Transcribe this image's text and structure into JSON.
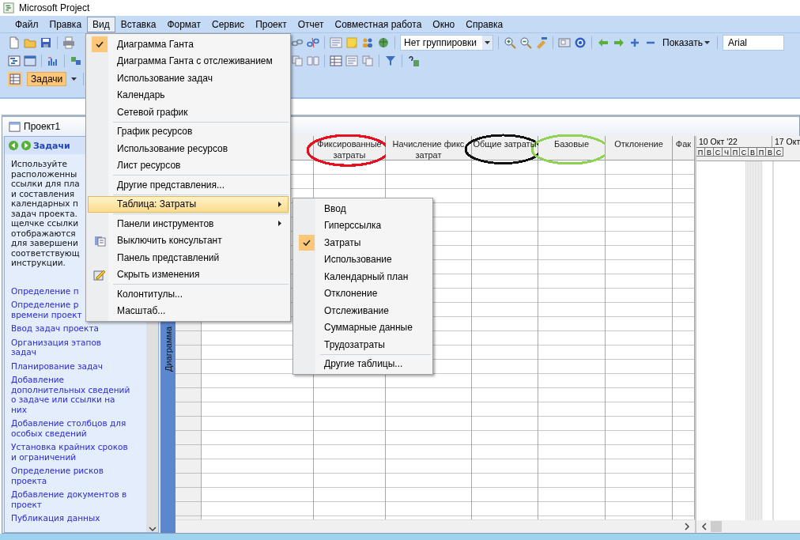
{
  "window": {
    "title": "Microsoft Project"
  },
  "menu_bar": [
    {
      "label": "Файл",
      "selected": false
    },
    {
      "label": "Правка",
      "selected": false
    },
    {
      "label": "Вид",
      "selected": true
    },
    {
      "label": "Вставка",
      "selected": false
    },
    {
      "label": "Формат",
      "selected": false
    },
    {
      "label": "Сервис",
      "selected": false
    },
    {
      "label": "Проект",
      "selected": false
    },
    {
      "label": "Отчет",
      "selected": false
    },
    {
      "label": "Совместная работа",
      "selected": false
    },
    {
      "label": "Окно",
      "selected": false
    },
    {
      "label": "Справка",
      "selected": false
    }
  ],
  "toolbar": {
    "grouping_combo": "Нет группировки",
    "show_button": "Показать",
    "font_field": "Arial",
    "view_button": "Задачи"
  },
  "project_window": {
    "title": "Проект1"
  },
  "task_pane": {
    "title": "Задачи",
    "description": "Используйте\nрасположенны\nссылки для пла\nи составления\nкалендарных п\nзадач проекта.\nщелчке ссылки\nотображаются\nдля завершени\nсоответствующ\nинструкции.",
    "links": [
      "Определение п",
      "Определение р\nвремени проект",
      "Ввод задач проекта",
      "Организация этапов\nзадач",
      "Планирование задач",
      "Добавление\nдополнительных сведений\nо задаче или ссылки на\nних",
      "Добавление столбцов для\nособых сведений",
      "Установка крайних сроков\nи ограничений",
      "Определение рисков\nпроекта",
      "Добавление документов в\nпроект",
      "Публикация данных"
    ]
  },
  "view_bar": {
    "label": "Диаграмма"
  },
  "table": {
    "columns": [
      {
        "label": "Фиксированные\nзатраты",
        "color": "#e8101e"
      },
      {
        "label": "Начисление фикс\nзатрат"
      },
      {
        "label": "Общие затраты",
        "color": "#111111"
      },
      {
        "label": "Базовые",
        "color": "#8fd150"
      },
      {
        "label": "Отклонение"
      },
      {
        "label": "Фак"
      }
    ]
  },
  "gantt": {
    "weeks": [
      "10 Окт '22",
      "17 Окт"
    ],
    "days": [
      "П",
      "В",
      "С",
      "Ч",
      "П",
      "С",
      "В",
      "П",
      "В",
      "С"
    ]
  },
  "view_menu": {
    "items": [
      {
        "label": "Диаграмма Ганта",
        "kind": "plain",
        "checked": true,
        "selected": false,
        "separator_after": false
      },
      {
        "label": "Диаграмма Ганта с отслеживанием",
        "kind": "plain",
        "checked": false,
        "selected": false,
        "separator_after": false
      },
      {
        "label": "Использование задач",
        "kind": "plain",
        "checked": false,
        "selected": false,
        "separator_after": false
      },
      {
        "label": "Календарь",
        "kind": "plain",
        "checked": false,
        "selected": false,
        "separator_after": false
      },
      {
        "label": "Сетевой график",
        "kind": "plain",
        "checked": false,
        "selected": false,
        "separator_after": true
      },
      {
        "label": "График ресурсов",
        "kind": "plain",
        "checked": false,
        "selected": false,
        "separator_after": false
      },
      {
        "label": "Использование ресурсов",
        "kind": "plain",
        "checked": false,
        "selected": false,
        "separator_after": false
      },
      {
        "label": "Лист ресурсов",
        "kind": "plain",
        "checked": false,
        "selected": false,
        "separator_after": true
      },
      {
        "label": "Другие представления...",
        "kind": "plain",
        "checked": false,
        "selected": false,
        "separator_after": true
      },
      {
        "label": "Таблица: Затраты",
        "kind": "submenu",
        "checked": false,
        "selected": true,
        "separator_after": true
      },
      {
        "label": "Панели инструментов",
        "kind": "submenu",
        "checked": false,
        "selected": false,
        "separator_after": false
      },
      {
        "label": "Выключить консультант",
        "kind": "icon",
        "checked": false,
        "selected": false,
        "separator_after": false
      },
      {
        "label": "Панель представлений",
        "kind": "plain",
        "checked": false,
        "selected": false,
        "separator_after": false
      },
      {
        "label": "Скрыть изменения",
        "kind": "icon",
        "checked": false,
        "selected": false,
        "separator_after": true
      },
      {
        "label": "Колонтитулы...",
        "kind": "plain",
        "checked": false,
        "selected": false,
        "separator_after": false
      },
      {
        "label": "Масштаб...",
        "kind": "plain",
        "checked": false,
        "selected": false,
        "separator_after": false
      }
    ]
  },
  "table_submenu": {
    "items": [
      {
        "label": "Ввод",
        "kind": "plain",
        "checked": false,
        "selected": false,
        "separator_after": false
      },
      {
        "label": "Гиперссылка",
        "kind": "plain",
        "checked": false,
        "selected": false,
        "separator_after": false
      },
      {
        "label": "Затраты",
        "kind": "plain",
        "checked": true,
        "selected": false,
        "separator_after": false
      },
      {
        "label": "Использование",
        "kind": "plain",
        "checked": false,
        "selected": false,
        "separator_after": false
      },
      {
        "label": "Календарный план",
        "kind": "plain",
        "checked": false,
        "selected": false,
        "separator_after": false
      },
      {
        "label": "Отклонение",
        "kind": "plain",
        "checked": false,
        "selected": false,
        "separator_after": false
      },
      {
        "label": "Отслеживание",
        "kind": "plain",
        "checked": false,
        "selected": false,
        "separator_after": false
      },
      {
        "label": "Суммарные данные",
        "kind": "plain",
        "checked": false,
        "selected": false,
        "separator_after": false
      },
      {
        "label": "Трудозатраты",
        "kind": "plain",
        "checked": false,
        "selected": false,
        "separator_after": true
      },
      {
        "label": "Другие таблицы...",
        "kind": "plain",
        "checked": false,
        "selected": false,
        "separator_after": false
      }
    ]
  }
}
